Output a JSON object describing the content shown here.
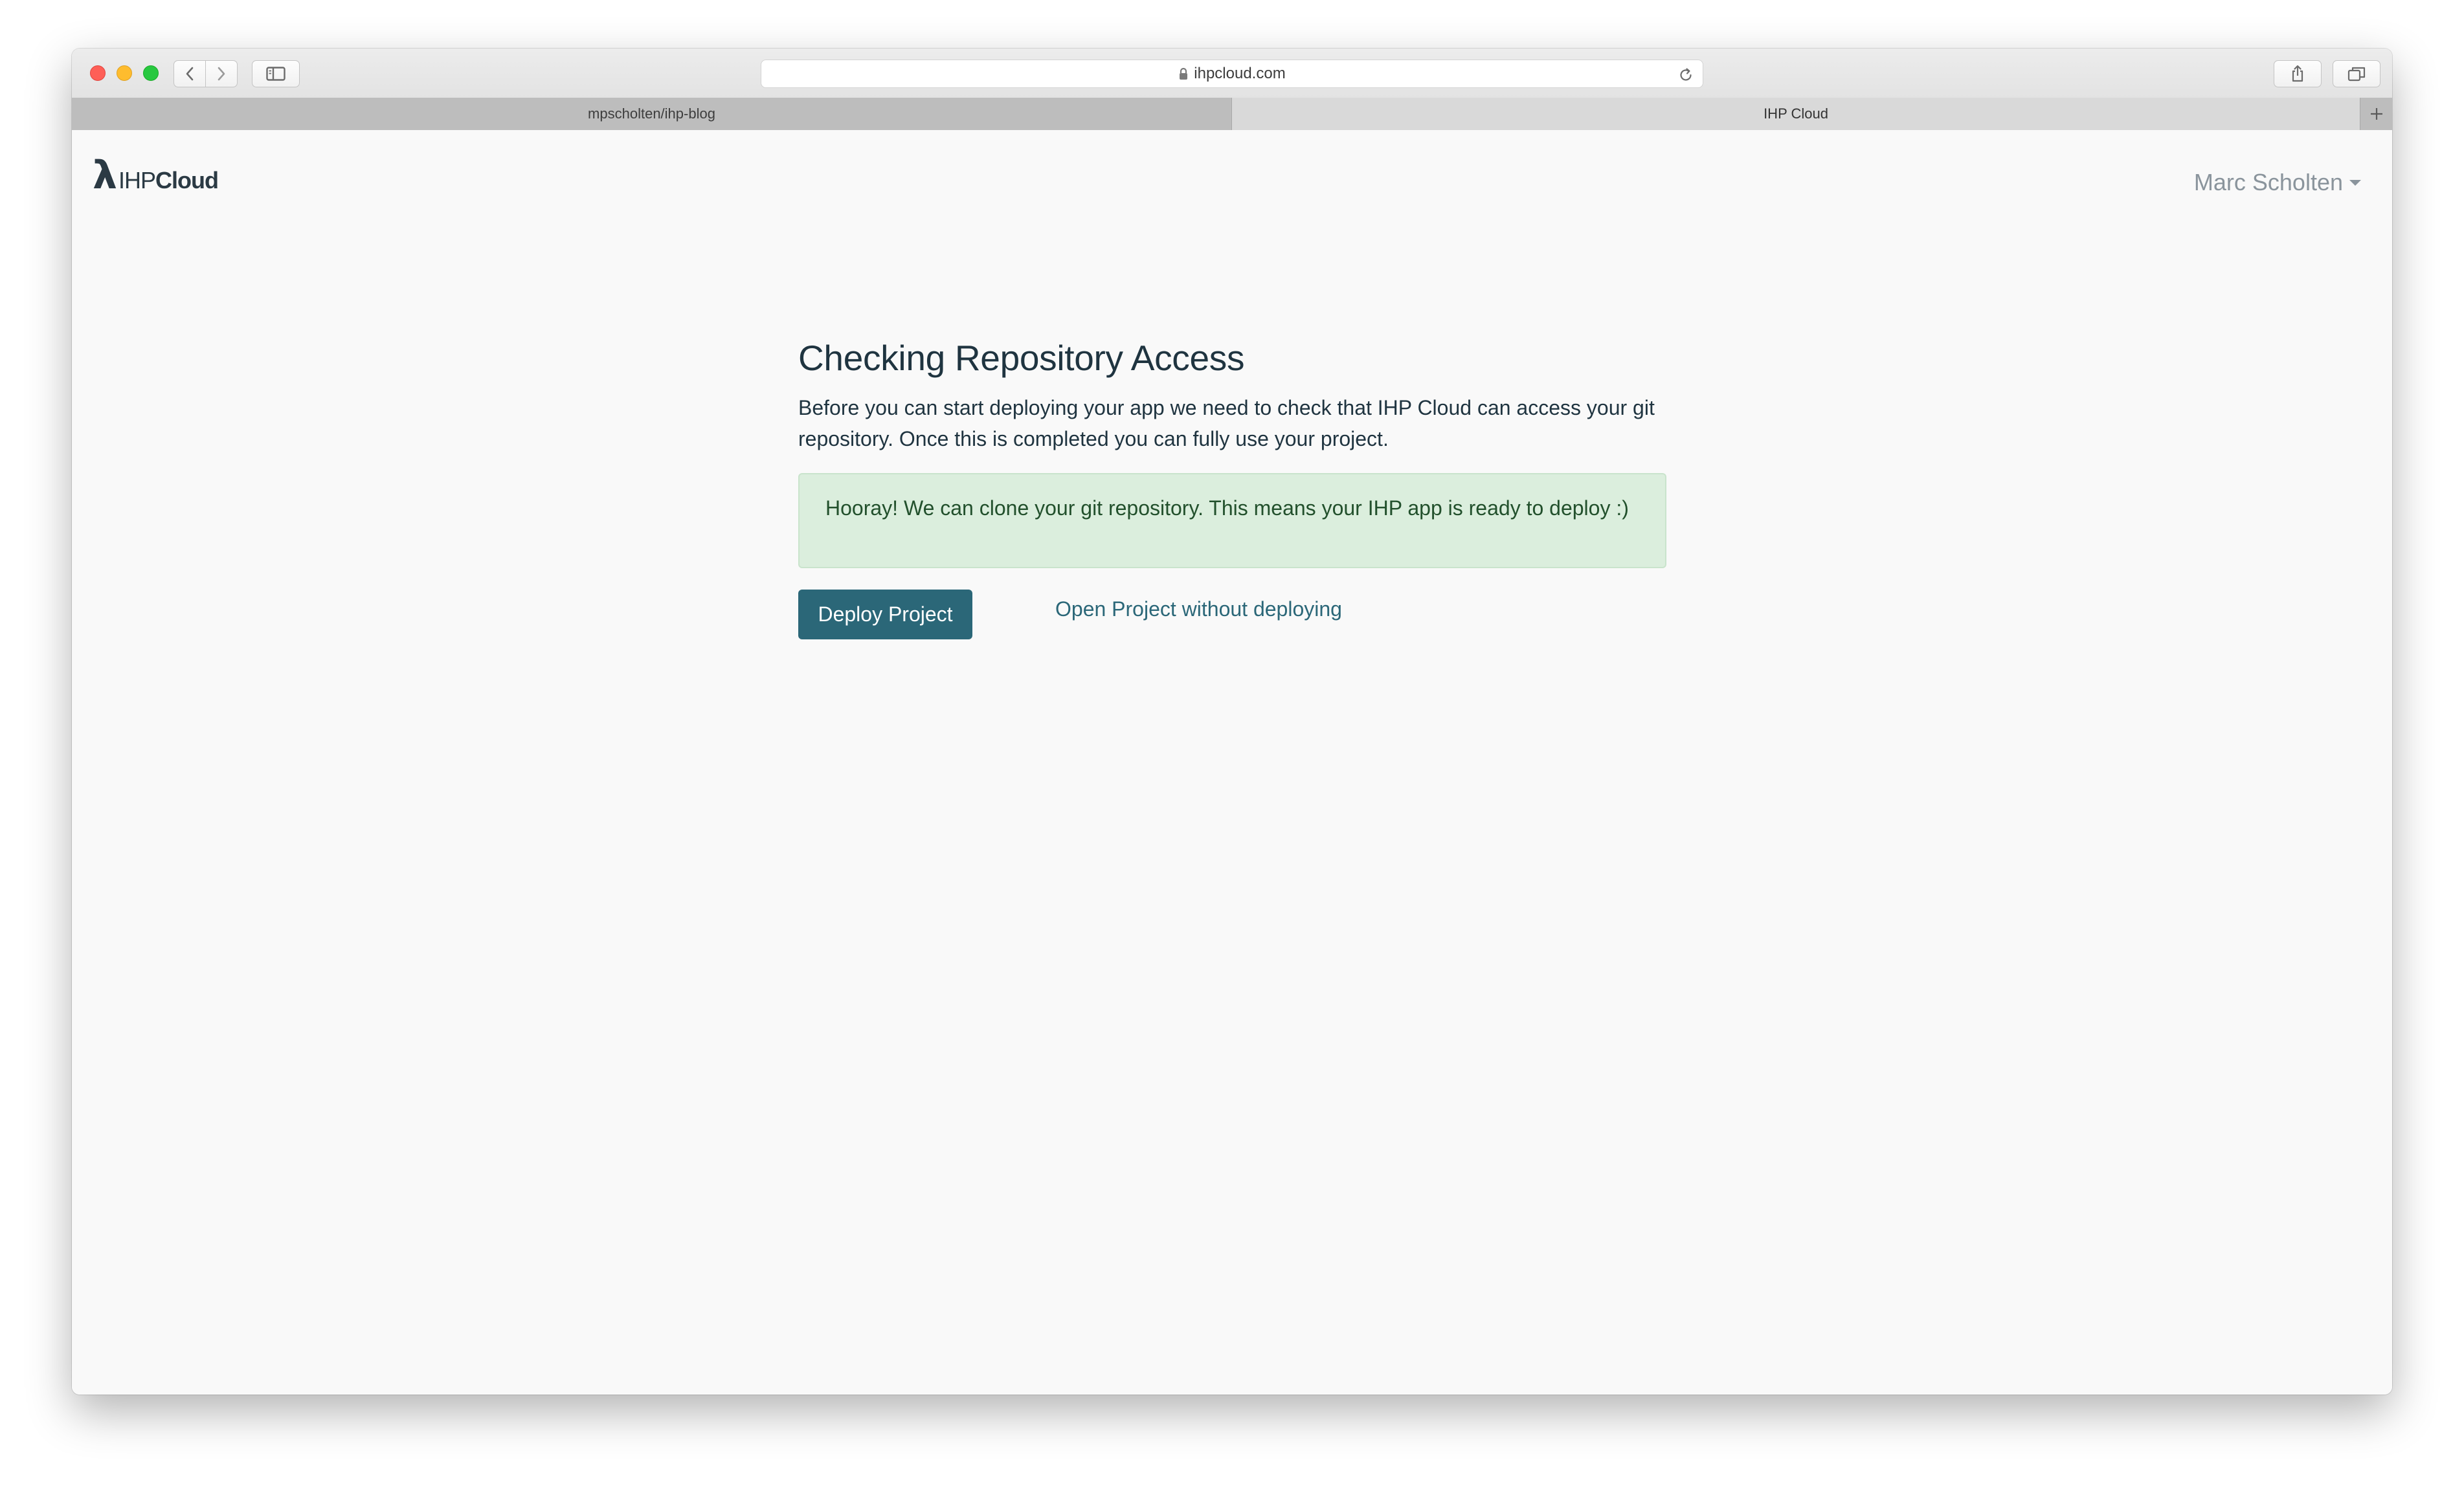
{
  "browser": {
    "address": "ihpcloud.com",
    "tabs": [
      {
        "label": "mpscholten/ihp-blog",
        "active": false
      },
      {
        "label": "IHP Cloud",
        "active": true
      }
    ],
    "icons": [
      "lock-icon",
      "reload-icon",
      "back-icon",
      "forward-icon",
      "sidebar-icon",
      "share-icon",
      "tabs-overview-icon",
      "plus-icon"
    ]
  },
  "header": {
    "logo_lambda": "λ",
    "logo_ihp": "IHP",
    "logo_cloud": "Cloud",
    "user_name": "Marc Scholten"
  },
  "main": {
    "title": "Checking Repository Access",
    "intro": "Before you can start deploying your app we need to check that IHP Cloud can access your git repository. Once this is completed you can fully use your project.",
    "alert": "Hooray! We can clone your git repository. This means your IHP app is ready to deploy :)",
    "deploy_label": "Deploy Project",
    "open_label": "Open Project without deploying"
  },
  "colors": {
    "accent": "#2b6778",
    "success_bg": "#dbeedd",
    "success_text": "#22502c",
    "text": "#1f3440",
    "muted": "#8a949c"
  }
}
